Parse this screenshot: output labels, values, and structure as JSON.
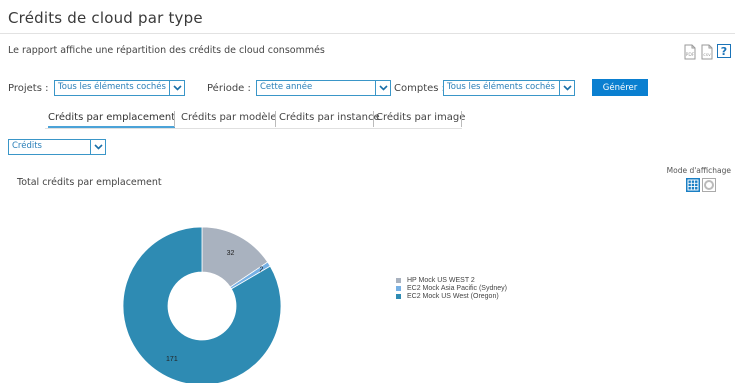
{
  "page": {
    "title": "Crédits de cloud par type",
    "description": "Le rapport affiche une répartition des crédits de cloud consommés"
  },
  "toolbar": {
    "pdf_icon": "pdf-export-icon",
    "csv_icon": "csv-export-icon",
    "help_label": "?"
  },
  "filters": {
    "projects_label": "Projets :",
    "projects_value": "Tous les éléments cochés",
    "period_label": "Période :",
    "period_value": "Cette année",
    "accounts_label": "Comptes :",
    "accounts_value": "Tous les éléments cochés",
    "generate_label": "Générer"
  },
  "tabs": [
    {
      "label": "Crédits par emplacement",
      "active": true
    },
    {
      "label": "Crédits par modèle",
      "active": false
    },
    {
      "label": "Crédits par instance",
      "active": false
    },
    {
      "label": "Crédits par image",
      "active": false
    }
  ],
  "metric_select": {
    "value": "Crédits"
  },
  "display_mode": {
    "label": "Mode d'affichage",
    "options": [
      "table-icon",
      "chart-icon"
    ]
  },
  "colors": {
    "accent": "#0a7fd0",
    "border": "#3a96c8"
  },
  "chart_data": {
    "type": "pie",
    "title": "Total crédits par emplacement",
    "donut": true,
    "legend_position": "right",
    "slices": [
      {
        "label": "HP Mock US WEST 2",
        "value": 32,
        "color": "#a9b2bf"
      },
      {
        "label": "EC2 Mock Asia Pacific (Sydney)",
        "value": 2,
        "color": "#76b0e4"
      },
      {
        "label": "EC2 Mock US West (Oregon)",
        "value": 171,
        "color": "#2e8bb3"
      }
    ]
  }
}
